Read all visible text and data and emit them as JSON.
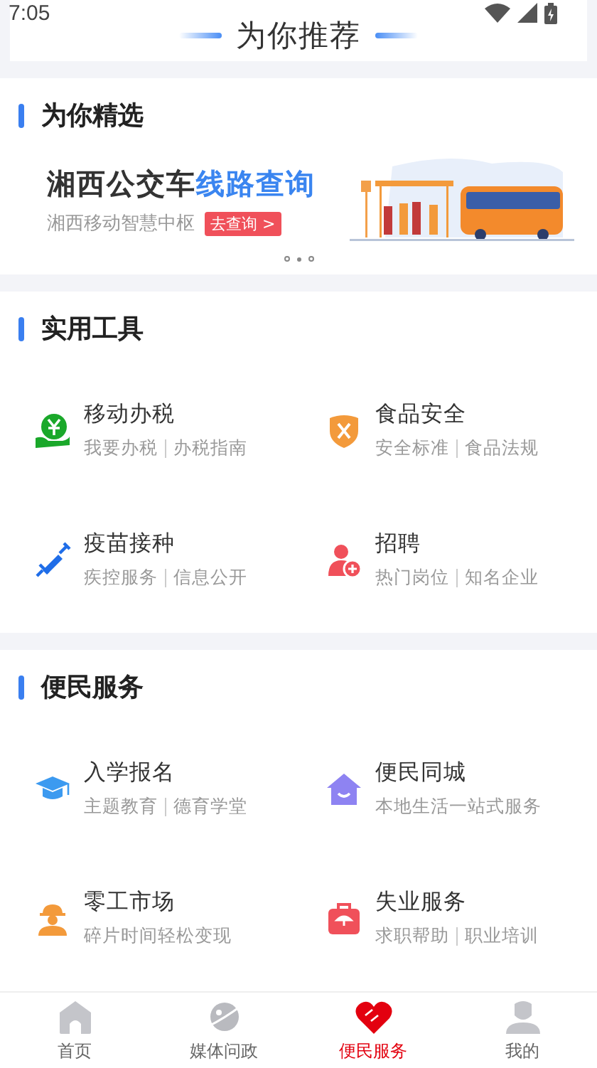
{
  "status_bar": {
    "time": "7:05"
  },
  "header": {
    "title": "为你推荐"
  },
  "featured": {
    "title": "为你精选",
    "banner": {
      "title": "湘西公交车",
      "title_highlight": "线路查询",
      "subtitle": "湘西移动智慧中枢",
      "button": "去查询 >"
    },
    "dots": [
      {
        "selected": false
      },
      {
        "selected": true
      },
      {
        "selected": false
      }
    ]
  },
  "sections": [
    {
      "title": "实用工具",
      "items": [
        {
          "title": "移动办税",
          "subtitles": [
            "我要办税",
            "办税指南"
          ]
        },
        {
          "title": "食品安全",
          "subtitles": [
            "安全标准",
            "食品法规"
          ]
        },
        {
          "title": "疫苗接种",
          "subtitles": [
            "疾控服务",
            "信息公开"
          ]
        },
        {
          "title": "招聘",
          "subtitles": [
            "热门岗位",
            "知名企业"
          ]
        }
      ]
    },
    {
      "title": "便民服务",
      "items": [
        {
          "title": "入学报名",
          "subtitles": [
            "主题教育",
            "德育学堂"
          ]
        },
        {
          "title": "便民同城",
          "subtitles": [
            "本地生活一站式服务"
          ]
        },
        {
          "title": "零工市场",
          "subtitles": [
            "碎片时间轻松变现"
          ]
        },
        {
          "title": "失业服务",
          "subtitles": [
            "求职帮助",
            "职业培训"
          ]
        }
      ]
    }
  ],
  "tab_bar": [
    {
      "label": "首页",
      "selected": false
    },
    {
      "label": "媒体问政",
      "selected": false
    },
    {
      "label": "便民服务",
      "selected": true
    },
    {
      "label": "我的",
      "selected": false
    }
  ]
}
